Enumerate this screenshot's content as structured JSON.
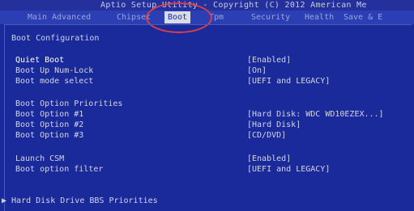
{
  "header": {
    "title": "Aptio Setup Utility - Copyright (C) 2012 American Me"
  },
  "tabs": [
    {
      "label": "Main",
      "active": false
    },
    {
      "label": "Advanced",
      "active": false
    },
    {
      "label": "Chipset",
      "active": false
    },
    {
      "label": "Boot",
      "active": true
    },
    {
      "label": "Tpm",
      "active": false
    },
    {
      "label": "Security",
      "active": false
    },
    {
      "label": "Health",
      "active": false
    },
    {
      "label": "Save & E",
      "active": false
    }
  ],
  "colors": {
    "background": "#1b2a9a",
    "tab_bar": "#2c3eb4",
    "active_tab": "#d9dce8",
    "annotation_circle": "#d8404c"
  },
  "boot": {
    "section_title": "Boot Configuration",
    "quiet_boot_label": "Quiet Boot",
    "quiet_boot_value": "[Enabled]",
    "numlock_label": "Boot Up Num-Lock",
    "numlock_value": "[On]",
    "mode_label": "Boot mode select",
    "mode_value": "[UEFI and LEGACY]",
    "priorities_title": "Boot Option Priorities",
    "option1_label": "Boot Option #1",
    "option1_value": "[Hard Disk: WDC WD10EZEX...]",
    "option2_label": "Boot Option #2",
    "option2_value": "[Hard Disk]",
    "option3_label": "Boot Option #3",
    "option3_value": "[CD/DVD]",
    "csm_label": "Launch CSM",
    "csm_value": "[Enabled]",
    "filter_label": "Boot option filter",
    "filter_value": "[UEFI and LEGACY]",
    "bbs_label": "▶ Hard Disk Drive BBS Priorities"
  }
}
